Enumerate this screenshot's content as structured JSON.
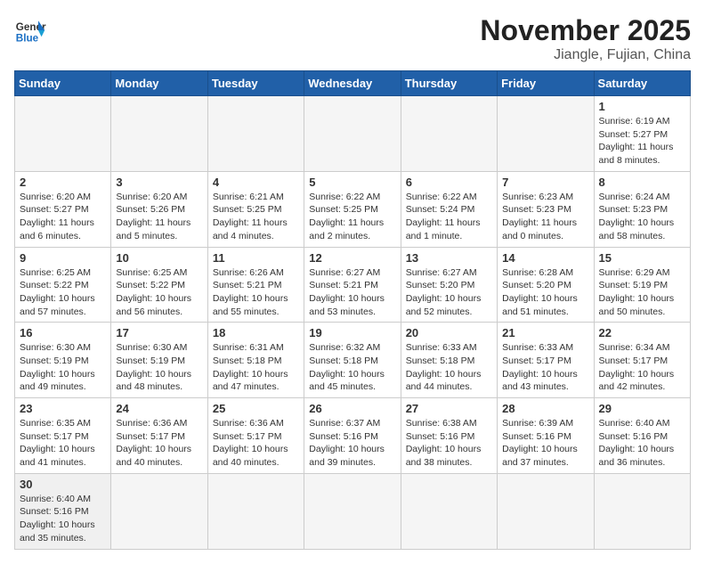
{
  "header": {
    "logo_general": "General",
    "logo_blue": "Blue",
    "month_title": "November 2025",
    "location": "Jiangle, Fujian, China"
  },
  "days_of_week": [
    "Sunday",
    "Monday",
    "Tuesday",
    "Wednesday",
    "Thursday",
    "Friday",
    "Saturday"
  ],
  "weeks": [
    [
      {
        "day": "",
        "info": ""
      },
      {
        "day": "",
        "info": ""
      },
      {
        "day": "",
        "info": ""
      },
      {
        "day": "",
        "info": ""
      },
      {
        "day": "",
        "info": ""
      },
      {
        "day": "",
        "info": ""
      },
      {
        "day": "1",
        "info": "Sunrise: 6:19 AM\nSunset: 5:27 PM\nDaylight: 11 hours and 8 minutes."
      }
    ],
    [
      {
        "day": "2",
        "info": "Sunrise: 6:20 AM\nSunset: 5:27 PM\nDaylight: 11 hours and 6 minutes."
      },
      {
        "day": "3",
        "info": "Sunrise: 6:20 AM\nSunset: 5:26 PM\nDaylight: 11 hours and 5 minutes."
      },
      {
        "day": "4",
        "info": "Sunrise: 6:21 AM\nSunset: 5:25 PM\nDaylight: 11 hours and 4 minutes."
      },
      {
        "day": "5",
        "info": "Sunrise: 6:22 AM\nSunset: 5:25 PM\nDaylight: 11 hours and 2 minutes."
      },
      {
        "day": "6",
        "info": "Sunrise: 6:22 AM\nSunset: 5:24 PM\nDaylight: 11 hours and 1 minute."
      },
      {
        "day": "7",
        "info": "Sunrise: 6:23 AM\nSunset: 5:23 PM\nDaylight: 11 hours and 0 minutes."
      },
      {
        "day": "8",
        "info": "Sunrise: 6:24 AM\nSunset: 5:23 PM\nDaylight: 10 hours and 58 minutes."
      }
    ],
    [
      {
        "day": "9",
        "info": "Sunrise: 6:25 AM\nSunset: 5:22 PM\nDaylight: 10 hours and 57 minutes."
      },
      {
        "day": "10",
        "info": "Sunrise: 6:25 AM\nSunset: 5:22 PM\nDaylight: 10 hours and 56 minutes."
      },
      {
        "day": "11",
        "info": "Sunrise: 6:26 AM\nSunset: 5:21 PM\nDaylight: 10 hours and 55 minutes."
      },
      {
        "day": "12",
        "info": "Sunrise: 6:27 AM\nSunset: 5:21 PM\nDaylight: 10 hours and 53 minutes."
      },
      {
        "day": "13",
        "info": "Sunrise: 6:27 AM\nSunset: 5:20 PM\nDaylight: 10 hours and 52 minutes."
      },
      {
        "day": "14",
        "info": "Sunrise: 6:28 AM\nSunset: 5:20 PM\nDaylight: 10 hours and 51 minutes."
      },
      {
        "day": "15",
        "info": "Sunrise: 6:29 AM\nSunset: 5:19 PM\nDaylight: 10 hours and 50 minutes."
      }
    ],
    [
      {
        "day": "16",
        "info": "Sunrise: 6:30 AM\nSunset: 5:19 PM\nDaylight: 10 hours and 49 minutes."
      },
      {
        "day": "17",
        "info": "Sunrise: 6:30 AM\nSunset: 5:19 PM\nDaylight: 10 hours and 48 minutes."
      },
      {
        "day": "18",
        "info": "Sunrise: 6:31 AM\nSunset: 5:18 PM\nDaylight: 10 hours and 47 minutes."
      },
      {
        "day": "19",
        "info": "Sunrise: 6:32 AM\nSunset: 5:18 PM\nDaylight: 10 hours and 45 minutes."
      },
      {
        "day": "20",
        "info": "Sunrise: 6:33 AM\nSunset: 5:18 PM\nDaylight: 10 hours and 44 minutes."
      },
      {
        "day": "21",
        "info": "Sunrise: 6:33 AM\nSunset: 5:17 PM\nDaylight: 10 hours and 43 minutes."
      },
      {
        "day": "22",
        "info": "Sunrise: 6:34 AM\nSunset: 5:17 PM\nDaylight: 10 hours and 42 minutes."
      }
    ],
    [
      {
        "day": "23",
        "info": "Sunrise: 6:35 AM\nSunset: 5:17 PM\nDaylight: 10 hours and 41 minutes."
      },
      {
        "day": "24",
        "info": "Sunrise: 6:36 AM\nSunset: 5:17 PM\nDaylight: 10 hours and 40 minutes."
      },
      {
        "day": "25",
        "info": "Sunrise: 6:36 AM\nSunset: 5:17 PM\nDaylight: 10 hours and 40 minutes."
      },
      {
        "day": "26",
        "info": "Sunrise: 6:37 AM\nSunset: 5:16 PM\nDaylight: 10 hours and 39 minutes."
      },
      {
        "day": "27",
        "info": "Sunrise: 6:38 AM\nSunset: 5:16 PM\nDaylight: 10 hours and 38 minutes."
      },
      {
        "day": "28",
        "info": "Sunrise: 6:39 AM\nSunset: 5:16 PM\nDaylight: 10 hours and 37 minutes."
      },
      {
        "day": "29",
        "info": "Sunrise: 6:40 AM\nSunset: 5:16 PM\nDaylight: 10 hours and 36 minutes."
      }
    ],
    [
      {
        "day": "30",
        "info": "Sunrise: 6:40 AM\nSunset: 5:16 PM\nDaylight: 10 hours and 35 minutes."
      },
      {
        "day": "",
        "info": ""
      },
      {
        "day": "",
        "info": ""
      },
      {
        "day": "",
        "info": ""
      },
      {
        "day": "",
        "info": ""
      },
      {
        "day": "",
        "info": ""
      },
      {
        "day": "",
        "info": ""
      }
    ]
  ]
}
